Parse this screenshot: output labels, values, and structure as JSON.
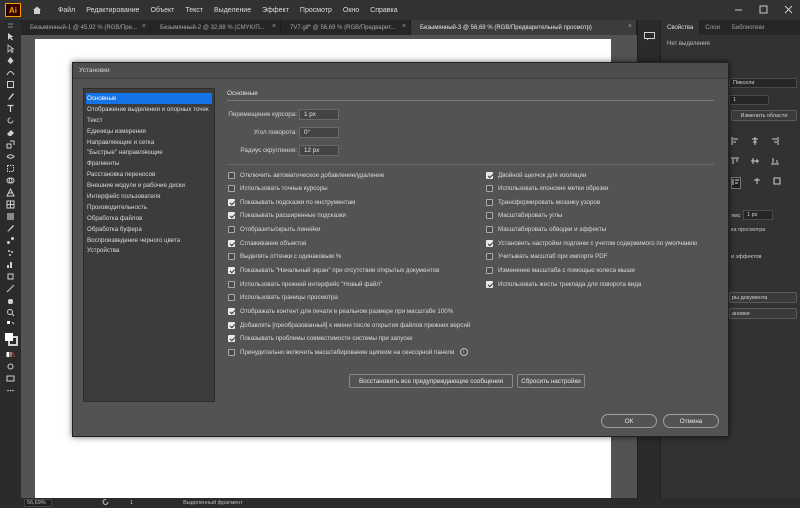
{
  "app": {
    "logo_text": "Ai",
    "menu": [
      "Файл",
      "Редактирование",
      "Объект",
      "Текст",
      "Выделение",
      "Эффект",
      "Просмотр",
      "Окно",
      "Справка"
    ]
  },
  "tabs": [
    {
      "label": "Безымянный-1 @ 45,92 % (RGB/Пре...",
      "close": "×",
      "active": false
    },
    {
      "label": "Безымянный-2 @ 32,88 % (CMYK/П...",
      "close": "×",
      "active": false
    },
    {
      "label": "7V7.gif* @ 56,69 % (RGB/Предварит...",
      "close": "×",
      "active": false
    },
    {
      "label": "Безымянный-3 @ 56,69 % (RGB/Предварительный просмотр)",
      "close": "×",
      "active": true
    }
  ],
  "right_panel": {
    "tabs": [
      "Свойства",
      "Слои",
      "Библиотеки"
    ],
    "no_selection": "Нет выделения",
    "units": "Пиксели",
    "artboard_num": "1",
    "edit_artboard_btn": "Изменить области",
    "field_value": "1 px",
    "snippet_1": "ямс",
    "snippet_2": "ка просмотра",
    "snippet_3": "и эффектов",
    "doc_btn": "ры документа",
    "pref_btn": "ановки"
  },
  "status": {
    "zoom": "56,69%",
    "page": "1",
    "selection": "Выделенный фрагмент"
  },
  "dialog": {
    "title": "Установки",
    "sidebar": [
      "Основные",
      "Отображение выделения и опорных точек",
      "Текст",
      "Единицы измерения",
      "Направляющие и сетка",
      "\"Быстрые\" направляющие",
      "Фрагменты",
      "Расстановка переносов",
      "Внешние модули и рабочие диски",
      "Интерфейс пользователя",
      "Производительность",
      "Обработка файлов",
      "Обработка буфера",
      "Воспроизведение черного цвета",
      "Устройства"
    ],
    "section_title": "Основные",
    "fields": [
      {
        "label": "Перемещение курсора:",
        "value": "1 px"
      },
      {
        "label": "Угол поворота:",
        "value": "0°"
      },
      {
        "label": "Радиус скругления:",
        "value": "12 px"
      }
    ],
    "left_options": [
      {
        "label": "Отключить автоматическое добавление/удаление",
        "checked": false
      },
      {
        "label": "Использовать точные курсоры",
        "checked": false
      },
      {
        "label": "Показывать подсказки по инструментам",
        "checked": true
      },
      {
        "label": "Показывать расширенные подсказки",
        "checked": true
      },
      {
        "label": "Отобразить/скрыть линейки",
        "checked": false
      },
      {
        "label": "Сглаживание объектов",
        "checked": true
      },
      {
        "label": "Выделять оттенки с одинаковым %",
        "checked": false
      },
      {
        "label": "Показывать \"Начальный экран\" при отсутствии открытых документов",
        "checked": true
      },
      {
        "label": "Использовать прежний интерфейс \"Новый файл\"",
        "checked": false
      },
      {
        "label": "Использовать границы просмотра",
        "checked": false
      },
      {
        "label": "Отображать контент для печати в реальном размере при масштабе 100%",
        "checked": true
      },
      {
        "label": "Добавлять [преобразованный] к имени после открытия файлов прежних версий",
        "checked": true
      },
      {
        "label": "Показывать проблемы совместимости системы при запуске",
        "checked": true
      },
      {
        "label": "Принудительно включить масштабирование щипком на сенсорной панели",
        "checked": false
      }
    ],
    "right_options": [
      {
        "label": "Двойной щелчок для изоляции",
        "checked": true
      },
      {
        "label": "Использовать японские метки обрезки",
        "checked": false
      },
      {
        "label": "Трансформировать мозаику узоров",
        "checked": false
      },
      {
        "label": "Масштабировать углы",
        "checked": false
      },
      {
        "label": "Масштабировать обводки и эффекты",
        "checked": false
      },
      {
        "label": "Установить настройки подгонки с учетом содержимого по умолчанию",
        "checked": true
      },
      {
        "label": "Учитывать масштаб при импорте PDF",
        "checked": false
      },
      {
        "label": "Изменение масштаба с помощью колеса мыши",
        "checked": false
      },
      {
        "label": "Использовать жесты трекпада для поворота вида",
        "checked": true
      }
    ],
    "info_glyph": "i",
    "buttons": {
      "reset_warnings": "Восстановить все предупреждающие сообщения",
      "reset_prefs": "Сбросить настройки",
      "ok": "ОК",
      "cancel": "Отмена"
    }
  }
}
